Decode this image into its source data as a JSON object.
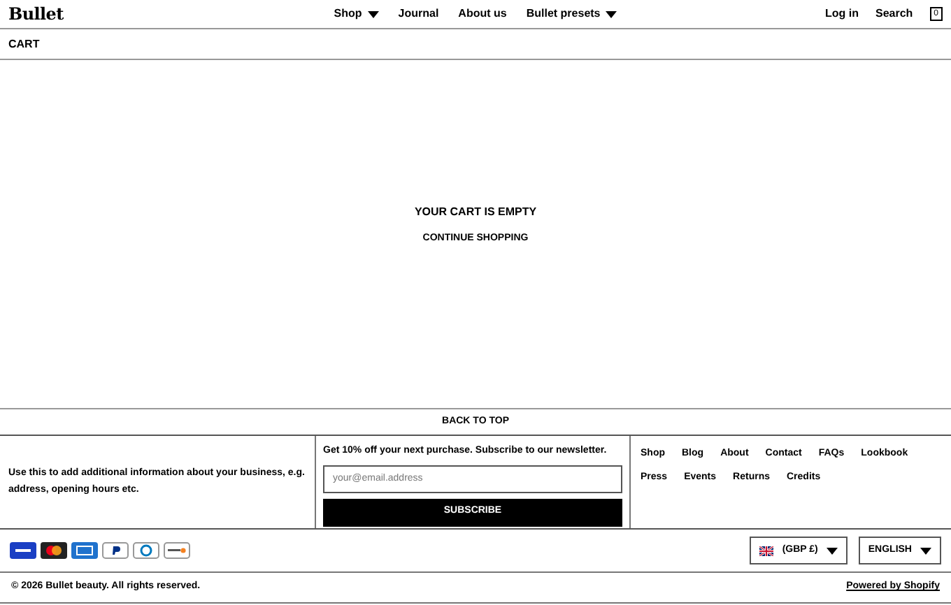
{
  "header": {
    "logo": "Bullet",
    "nav": [
      {
        "label": "Shop",
        "dropdown": true
      },
      {
        "label": "Journal",
        "dropdown": false
      },
      {
        "label": "About us",
        "dropdown": false
      },
      {
        "label": "Bullet presets",
        "dropdown": true
      }
    ],
    "actions": [
      "Log in",
      "Search"
    ],
    "cart_count": "0"
  },
  "page_title": "CART",
  "cart": {
    "message": "YOUR CART IS EMPTY",
    "link": "CONTINUE SHOPPING"
  },
  "back_to_top": "BACK TO TOP",
  "footer": {
    "info": "Use this to add additional information about your business, e.g. address, opening hours etc.",
    "newsletter": {
      "heading": "Get 10% off your next purchase. Subscribe to our newsletter.",
      "placeholder": "your@email.address",
      "button": "SUBSCRIBE"
    },
    "links": [
      "Shop",
      "Blog",
      "About",
      "Contact",
      "FAQs",
      "Lookbook",
      "Press",
      "Events",
      "Returns",
      "Credits"
    ],
    "payments": [
      {
        "kind": "visa"
      },
      {
        "kind": "mastercard"
      },
      {
        "kind": "amex"
      },
      {
        "kind": "paypal"
      },
      {
        "kind": "diners"
      },
      {
        "kind": "discover"
      }
    ],
    "currency": "(GBP £)",
    "language": "ENGLISH",
    "copyright": "© 2026 Bullet beauty. All rights reserved.",
    "powered": "Powered by Shopify"
  }
}
